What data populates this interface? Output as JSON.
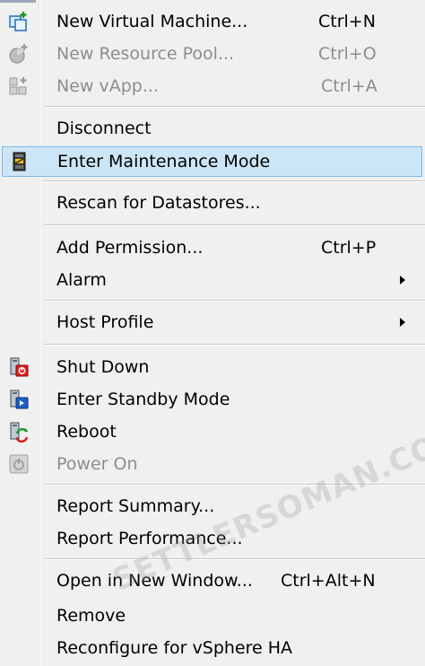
{
  "menu": {
    "items": [
      {
        "label": "New Virtual Machine...",
        "shortcut": "Ctrl+N",
        "icon": "new-vm-icon"
      },
      {
        "label": "New Resource Pool...",
        "shortcut": "Ctrl+O",
        "icon": "resource-pool-icon",
        "disabled": true
      },
      {
        "label": "New vApp...",
        "shortcut": "Ctrl+A",
        "icon": "vapp-icon",
        "disabled": true
      },
      {
        "label": "Disconnect"
      },
      {
        "label": "Enter Maintenance Mode",
        "icon": "maintenance-icon",
        "highlighted": true
      },
      {
        "label": "Rescan for Datastores..."
      },
      {
        "label": "Add Permission...",
        "shortcut": "Ctrl+P"
      },
      {
        "label": "Alarm",
        "submenu": true
      },
      {
        "label": "Host Profile",
        "submenu": true
      },
      {
        "label": "Shut Down",
        "icon": "shutdown-icon"
      },
      {
        "label": "Enter Standby Mode",
        "icon": "standby-icon"
      },
      {
        "label": "Reboot",
        "icon": "reboot-icon"
      },
      {
        "label": "Power On",
        "icon": "power-on-icon",
        "disabled": true
      },
      {
        "label": "Report Summary..."
      },
      {
        "label": "Report Performance..."
      },
      {
        "label": "Open in New Window...",
        "shortcut": "Ctrl+Alt+N"
      },
      {
        "label": "Remove"
      },
      {
        "label": "Reconfigure for vSphere HA"
      }
    ]
  },
  "watermark": "SETTLERSOMAN.COM",
  "colors": {
    "highlight_bg": "#cde6f7",
    "highlight_border": "#7ab8e6",
    "disabled_text": "#8d8d8d",
    "menu_bg": "#f0f0f0"
  }
}
